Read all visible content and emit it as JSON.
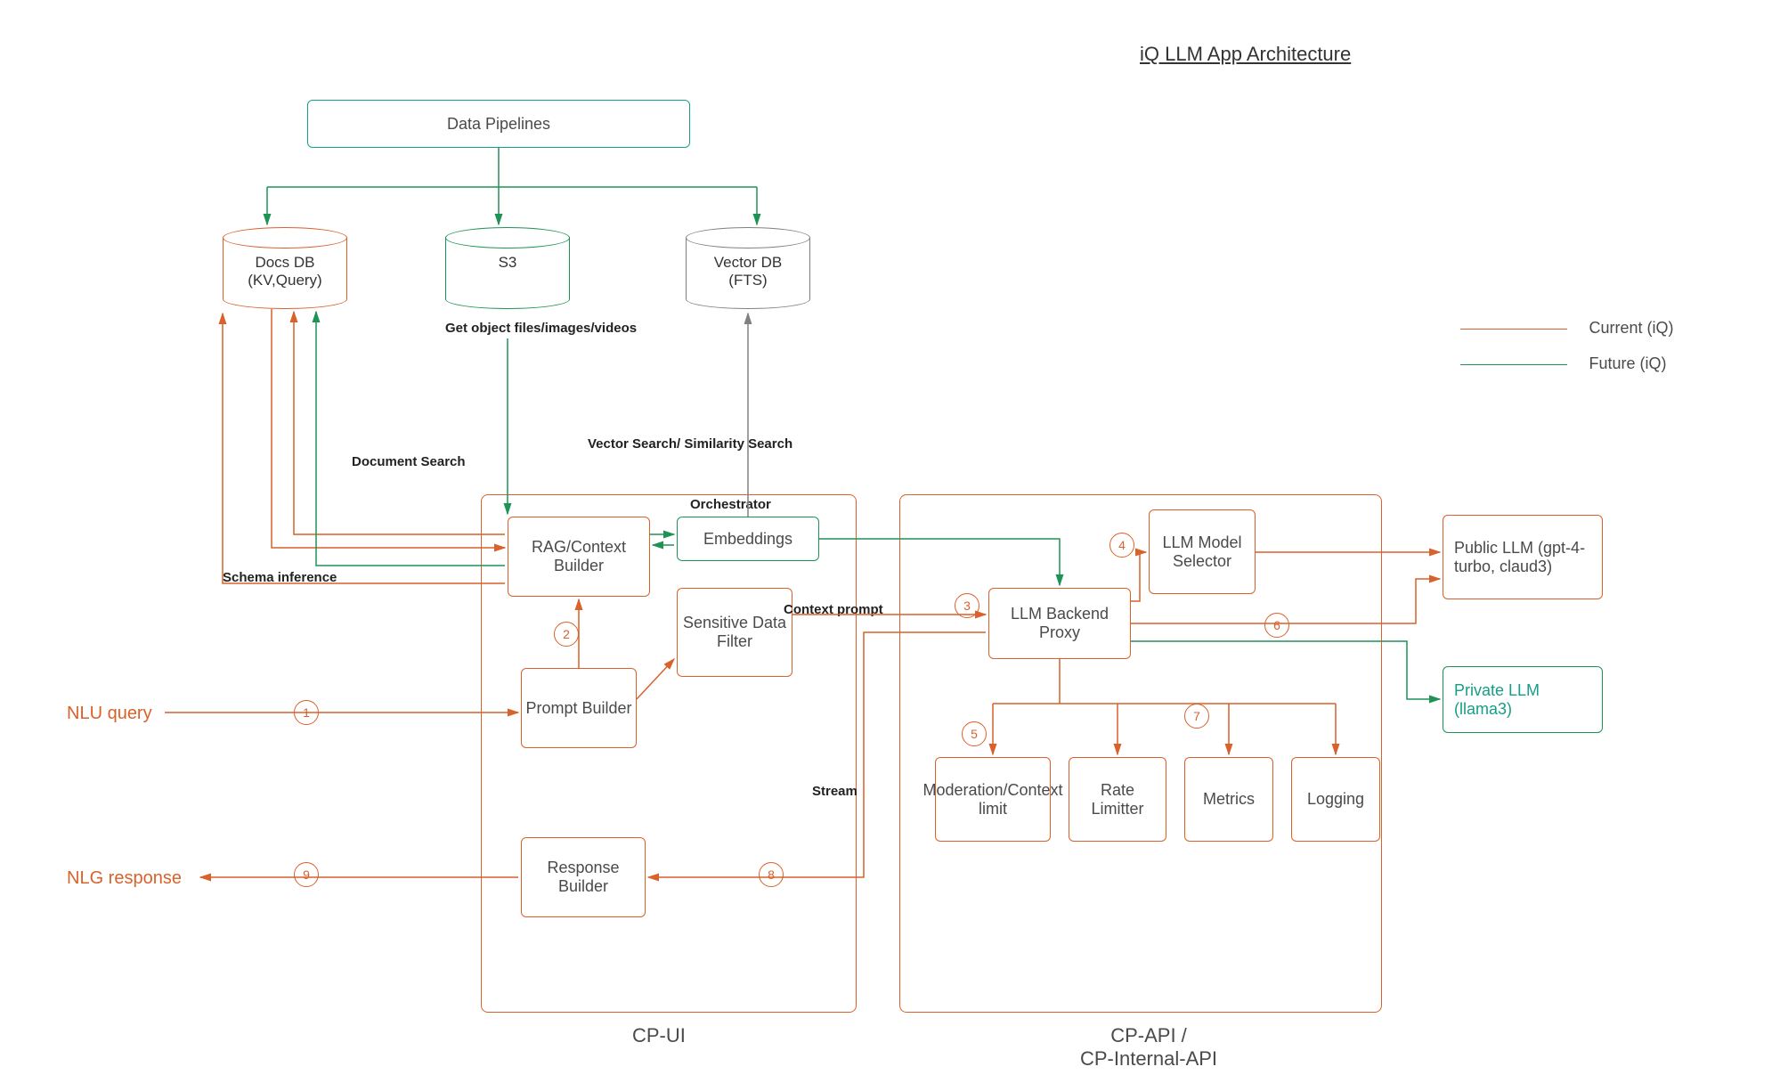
{
  "title": "iQ LLM App Architecture",
  "io": {
    "nlu": "NLU query",
    "nlg": "NLG response"
  },
  "top": {
    "pipelines": "Data Pipelines",
    "docs": "Docs DB\n(KV,Query)",
    "s3": "S3",
    "vector": "Vector DB\n(FTS)",
    "s3_caption": "Get object files/images/videos"
  },
  "edge_labels": {
    "schema": "Schema inference",
    "docsearch": "Document Search",
    "vectorsearch": "Vector Search/ Similarity Search",
    "orchestrator": "Orchestrator",
    "context_prompt": "Context prompt",
    "stream": "Stream"
  },
  "cpui": {
    "label": "CP-UI",
    "rag": "RAG/Context Builder",
    "embeddings": "Embeddings",
    "sensitive": "Sensitive Data Filter",
    "prompt": "Prompt Builder",
    "response": "Response Builder"
  },
  "cpapi": {
    "label": "CP-API /\nCP-Internal-API",
    "proxy": "LLM Backend Proxy",
    "selector": "LLM Model Selector",
    "moderation": "Moderation/Context limit",
    "rate": "Rate Limitter",
    "metrics": "Metrics",
    "logging": "Logging"
  },
  "right": {
    "public": "Public LLM (gpt-4-turbo, claud3)",
    "private": "Private LLM (llama3)"
  },
  "legend": {
    "current": "Current (iQ)",
    "future": "Future (iQ)"
  },
  "steps": {
    "s1": "1",
    "s2": "2",
    "s3": "3",
    "s4": "4",
    "s5": "5",
    "s6": "6",
    "s7": "7",
    "s8": "8",
    "s9": "9"
  },
  "colors": {
    "orange": "#D9612B",
    "green": "#1F9255",
    "grey": "#808080",
    "teal": "#169E86"
  }
}
